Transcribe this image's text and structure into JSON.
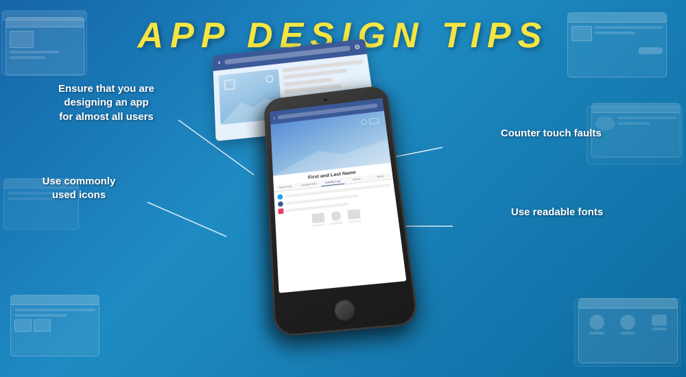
{
  "page": {
    "title": "APP DESIGN TIPS",
    "background_color": "#1a7bb5"
  },
  "annotations": {
    "ensure": {
      "line1": "Ensure that you are",
      "line2": "designing an app",
      "line3": "for almost all users"
    },
    "commonly": {
      "line1": "Use commonly",
      "line2": "used icons"
    },
    "counter": {
      "text": "Counter touch faults"
    },
    "readable": {
      "text": "Use readable fonts"
    }
  },
  "phone": {
    "nav_tabs": [
      "New Post",
      "Update Info",
      "Activity Log",
      "About",
      "More"
    ],
    "profile_name": "First and Last Name"
  }
}
